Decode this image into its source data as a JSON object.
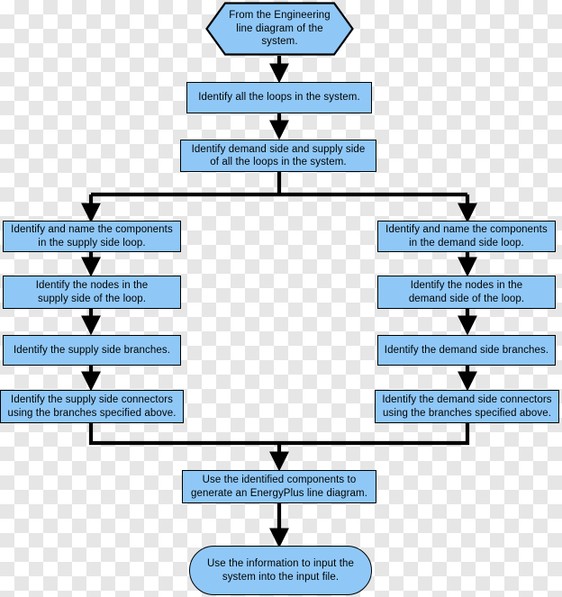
{
  "diagram": {
    "title": "EnergyPlus loop identification flowchart",
    "colors": {
      "node_fill": "#8fc8f7",
      "node_stroke": "#000000",
      "edge_stroke": "#000000",
      "text": "#000000",
      "background_checker_light": "#ffffff",
      "background_checker_dark": "#e6e6e6"
    },
    "nodes": [
      {
        "id": "start",
        "shape": "hexagon",
        "text": "From the Engineering\nline diagram of the\nsystem."
      },
      {
        "id": "identify-loops",
        "shape": "rect",
        "text": "Identify all the loops in the system."
      },
      {
        "id": "identify-demand-supply",
        "shape": "rect",
        "text": "Identify demand side and supply side\nof all the loops in the system."
      },
      {
        "id": "supply-components",
        "shape": "rect",
        "text": "Identify and name the components\nin the supply side loop."
      },
      {
        "id": "supply-nodes",
        "shape": "rect",
        "text": "Identify the nodes in the\nsupply side of the loop."
      },
      {
        "id": "supply-branches",
        "shape": "rect",
        "text": "Identify the supply side branches."
      },
      {
        "id": "supply-connectors",
        "shape": "rect",
        "text": "Identify the supply side connectors\nusing the branches specified above."
      },
      {
        "id": "demand-components",
        "shape": "rect",
        "text": "Identify and name the components\nin the demand side loop."
      },
      {
        "id": "demand-nodes",
        "shape": "rect",
        "text": "Identify the nodes in the\ndemand side of the loop."
      },
      {
        "id": "demand-branches",
        "shape": "rect",
        "text": "Identify the demand side branches."
      },
      {
        "id": "demand-connectors",
        "shape": "rect",
        "text": "Identify the demand side connectors\nusing the branches specified above."
      },
      {
        "id": "generate-line-diagram",
        "shape": "rect",
        "text": "Use the identified components to\ngenerate an EnergyPlus line diagram."
      },
      {
        "id": "input-file",
        "shape": "stadium",
        "text": "Use the information to input the\nsystem into the input file."
      }
    ]
  }
}
